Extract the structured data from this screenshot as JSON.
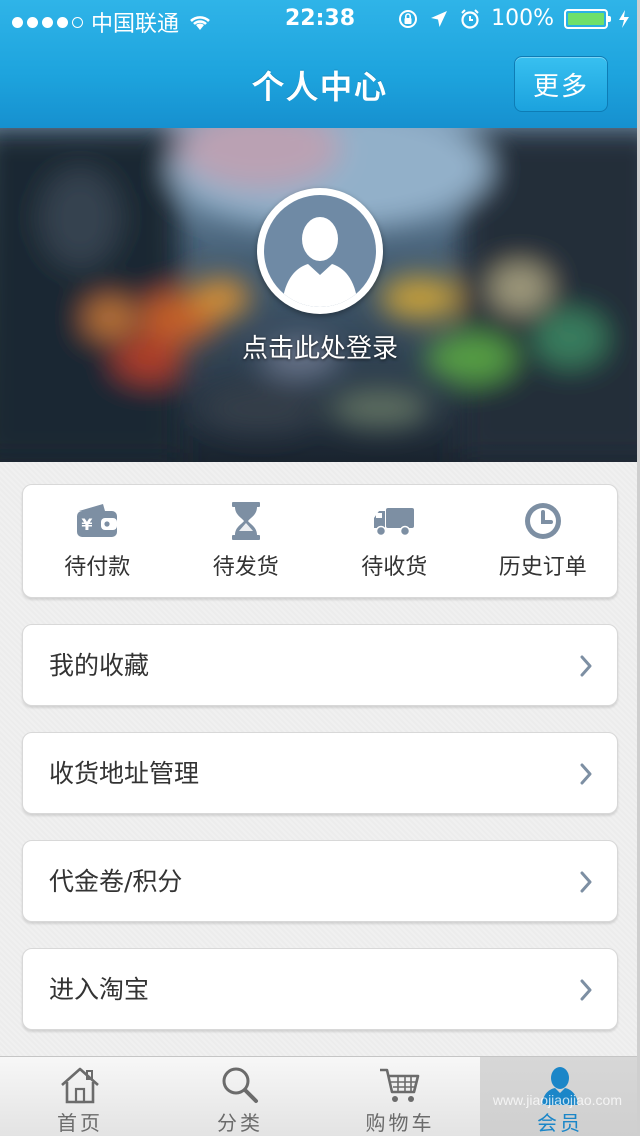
{
  "status_bar": {
    "carrier": "中国联通",
    "time": "22:38",
    "battery": "100%",
    "battery_level": 1.0,
    "signal_bars": 4,
    "signal_total": 5,
    "icons": [
      "wifi-icon",
      "rotation-lock-icon",
      "location-arrow-icon",
      "alarm-icon",
      "battery-icon",
      "charging-icon"
    ]
  },
  "navbar": {
    "title": "个人中心",
    "more_label": "更多"
  },
  "profile": {
    "login_prompt": "点击此处登录",
    "avatar_icon": "user-silhouette-icon"
  },
  "orders": [
    {
      "label": "待付款",
      "icon": "wallet-icon"
    },
    {
      "label": "待发货",
      "icon": "hourglass-icon"
    },
    {
      "label": "待收货",
      "icon": "truck-icon"
    },
    {
      "label": "历史订单",
      "icon": "clock-icon"
    }
  ],
  "menu": [
    {
      "label": "我的收藏"
    },
    {
      "label": "收货地址管理"
    },
    {
      "label": "代金卷/积分"
    },
    {
      "label": "进入淘宝"
    }
  ],
  "tabs": [
    {
      "label": "首页",
      "icon": "home-icon",
      "active": false
    },
    {
      "label": "分类",
      "icon": "search-icon",
      "active": false
    },
    {
      "label": "购物车",
      "icon": "cart-icon",
      "active": false
    },
    {
      "label": "会员",
      "icon": "member-icon",
      "active": true
    }
  ],
  "watermark": "www.jiaojiaojiao.com",
  "colors": {
    "header_blue": "#1da3dd",
    "active_tab": "#1b86c8",
    "icon_gray": "#7d8fa3",
    "battery_green": "#6fe06a"
  }
}
